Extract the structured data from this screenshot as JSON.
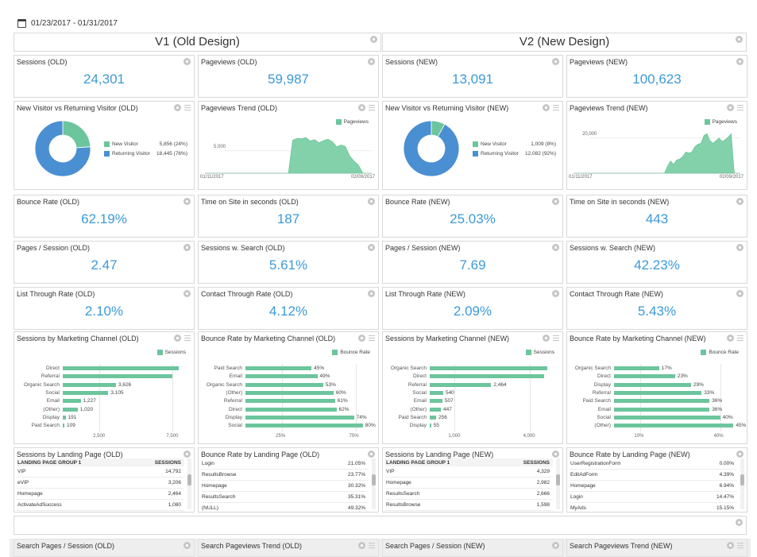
{
  "date_range": "01/23/2017 - 01/31/2017",
  "headers": {
    "left": "V1 (Old Design)",
    "right": "V2 (New Design)"
  },
  "kpis": {
    "sessions_old": {
      "title": "Sessions (OLD)",
      "value": "24,301"
    },
    "pageviews_old": {
      "title": "Pageviews (OLD)",
      "value": "59,987"
    },
    "sessions_new": {
      "title": "Sessions (NEW)",
      "value": "13,091"
    },
    "pageviews_new": {
      "title": "Pageviews (NEW)",
      "value": "100,623"
    },
    "bounce_old": {
      "title": "Bounce Rate (OLD)",
      "value": "62.19%"
    },
    "time_old": {
      "title": "Time on Site in seconds (OLD)",
      "value": "187"
    },
    "bounce_new": {
      "title": "Bounce Rate (NEW)",
      "value": "25.03%"
    },
    "time_new": {
      "title": "Time on Site in seconds (NEW)",
      "value": "443"
    },
    "pps_old": {
      "title": "Pages / Session (OLD)",
      "value": "2.47"
    },
    "search_old": {
      "title": "Sessions w. Search (OLD)",
      "value": "5.61%"
    },
    "pps_new": {
      "title": "Pages / Session (NEW)",
      "value": "7.69"
    },
    "search_new": {
      "title": "Sessions w. Search (NEW)",
      "value": "42.23%"
    },
    "ltr_old": {
      "title": "List Through Rate (OLD)",
      "value": "2.10%"
    },
    "ctr_old": {
      "title": "Contact Through Rate (OLD)",
      "value": "4.12%"
    },
    "ltr_new": {
      "title": "List Through Rate (NEW)",
      "value": "2.09%"
    },
    "ctr_new": {
      "title": "Contact Through Rate (NEW)",
      "value": "5.43%"
    }
  },
  "donut_old": {
    "title": "New Visitor vs Returning Visitor (OLD)",
    "items": [
      {
        "label": "New Visitor",
        "value": "5,856 (24%)",
        "share": 0.24,
        "color": "#6cc59c"
      },
      {
        "label": "Returning Visitor",
        "value": "18,445 (76%)",
        "share": 0.76,
        "color": "#4a8fd1"
      }
    ]
  },
  "donut_new": {
    "title": "New Visitor vs Returning Visitor (NEW)",
    "items": [
      {
        "label": "New Visitor",
        "value": "1,009 (8%)",
        "share": 0.08,
        "color": "#6cc59c"
      },
      {
        "label": "Returning Visitor",
        "value": "12,082 (92%)",
        "share": 0.92,
        "color": "#4a8fd1"
      }
    ]
  },
  "trend_old": {
    "title": "Pageviews Trend (OLD)",
    "legend": "Pageviews",
    "ytick": "5,000",
    "x_start": "01/11/2017",
    "x_end": "02/09/2017"
  },
  "trend_new": {
    "title": "Pageviews Trend (NEW)",
    "legend": "Pageviews",
    "ytick": "20,000",
    "x_start": "01/11/2017",
    "x_end": "02/09/2017"
  },
  "bottom_titles": [
    "Search Pages / Session (OLD)",
    "Search Pageviews Trend (OLD)",
    "Search Pages / Session (NEW)",
    "Search Pageviews Trend (NEW)"
  ],
  "tables": {
    "sess_landing_old": {
      "title": "Sessions by Landing Page (OLD)",
      "header": [
        "LANDING PAGE GROUP 1",
        "SESSIONS"
      ],
      "rows": [
        [
          "VIP",
          "14,792"
        ],
        [
          "eVIP",
          "3,206"
        ],
        [
          "Homepage",
          "2,464"
        ],
        [
          "ActivateAdSuccess",
          "1,080"
        ]
      ]
    },
    "bounce_landing_old": {
      "title": "Bounce Rate by Landing Page (OLD)",
      "header": null,
      "rows": [
        [
          "Login",
          "21.05%"
        ],
        [
          "ResultsBrowse",
          "23.77%"
        ],
        [
          "Homepage",
          "30.32%"
        ],
        [
          "ResultsSearch",
          "35.31%"
        ],
        [
          "(NULL)",
          "49.32%"
        ]
      ]
    },
    "sess_landing_new": {
      "title": "Sessions by Landing Page (NEW)",
      "header": [
        "LANDING PAGE GROUP 1",
        "SESSIONS"
      ],
      "rows": [
        [
          "VIP",
          "4,329"
        ],
        [
          "Homepage",
          "2,982"
        ],
        [
          "ResultsSearch",
          "2,666"
        ],
        [
          "ResultsBrowse",
          "1,598"
        ]
      ]
    },
    "bounce_landing_new": {
      "title": "Bounce Rate by Landing Page (NEW)",
      "header": null,
      "rows": [
        [
          "UserRegistrationForm",
          "0.00%"
        ],
        [
          "EditAdForm",
          "4.39%"
        ],
        [
          "Homepage",
          "6.94%"
        ],
        [
          "Login",
          "14.47%"
        ],
        [
          "MyAds",
          "15.15%"
        ]
      ]
    }
  },
  "chart_data": [
    {
      "type": "area",
      "title": "Pageviews Trend (OLD)",
      "series": [
        {
          "name": "Pageviews",
          "values": [
            0,
            0,
            0,
            0,
            0,
            0,
            0,
            0,
            0,
            0,
            0,
            0,
            0,
            0,
            0,
            0,
            0,
            0,
            0,
            0,
            7400,
            7800,
            7700,
            8000,
            7200,
            7500,
            6800,
            7300,
            7600,
            7100,
            5900,
            6300,
            6000,
            3800,
            2700,
            1800,
            0,
            0,
            0
          ]
        }
      ],
      "x": [
        "01/11/2017",
        "02/09/2017"
      ],
      "ytick_label": "5,000",
      "legend_position": "top-right"
    },
    {
      "type": "area",
      "title": "Pageviews Trend (NEW)",
      "series": [
        {
          "name": "Pageviews",
          "values": [
            0,
            0,
            0,
            0,
            0,
            0,
            0,
            0,
            0,
            0,
            0,
            0,
            0,
            0,
            0,
            0,
            0,
            0,
            0,
            0,
            0,
            0,
            0,
            0,
            0,
            0,
            0,
            0,
            0,
            0,
            0,
            4000,
            7000,
            5000,
            7500,
            8000,
            9500,
            12000,
            11500,
            12000,
            15000,
            16500,
            17000,
            21500,
            22500,
            18500,
            17000,
            18500,
            20000,
            18000,
            19000,
            20500,
            22500,
            0,
            0,
            0
          ]
        }
      ],
      "x": [
        "01/11/2017",
        "02/09/2017"
      ],
      "ytick_label": "20,000",
      "legend_position": "top-right"
    },
    {
      "type": "bar",
      "title": "Sessions by Marketing Channel (OLD)",
      "series": [
        {
          "name": "Sessions"
        }
      ],
      "categories": [
        "Direct",
        "Referral",
        "Organic Search",
        "Social",
        "Email",
        "(Other)",
        "Display",
        "Paid Search"
      ],
      "values": [
        7900,
        7500,
        3626,
        3105,
        1227,
        1020,
        191,
        109
      ],
      "labels": [
        "",
        "",
        "3,626",
        "3,105",
        "1,227",
        "1,020",
        "191",
        "109"
      ],
      "ticks": [
        "2,500",
        "7,500"
      ],
      "xlim": [
        0,
        8400
      ]
    },
    {
      "type": "bar",
      "title": "Bounce Rate by Marketing Channel (OLD)",
      "series": [
        {
          "name": "Bounce Rate"
        }
      ],
      "categories": [
        "Paid Search",
        "Email",
        "Organic Search",
        "(Other)",
        "Referral",
        "Direct",
        "Display",
        "Social"
      ],
      "values": [
        45,
        49,
        53,
        60,
        61,
        62,
        74,
        80
      ],
      "labels": [
        "45%",
        "49%",
        "53%",
        "60%",
        "61%",
        "62%",
        "74%",
        "80%"
      ],
      "ticks": [
        "25%",
        "75%"
      ],
      "xlim": [
        0,
        85
      ]
    },
    {
      "type": "bar",
      "title": "Sessions by Marketing Channel (NEW)",
      "series": [
        {
          "name": "Sessions"
        }
      ],
      "categories": [
        "Organic Search",
        "Direct",
        "Referral",
        "Social",
        "Email",
        "(Other)",
        "Paid Search",
        "Display"
      ],
      "values": [
        4700,
        4600,
        2464,
        540,
        507,
        447,
        256,
        55
      ],
      "labels": [
        "",
        "",
        "2,464",
        "540",
        "507",
        "447",
        "256",
        "55"
      ],
      "ticks": [
        "1,000",
        "4,000"
      ],
      "xlim": [
        0,
        5000
      ]
    },
    {
      "type": "bar",
      "title": "Bounce Rate by Marketing Channel (NEW)",
      "series": [
        {
          "name": "Bounce Rate"
        }
      ],
      "categories": [
        "Organic Search",
        "Direct",
        "Display",
        "Referral",
        "Paid Search",
        "Email",
        "Social",
        "(Other)"
      ],
      "values": [
        17,
        23,
        29,
        33,
        36,
        36,
        40,
        45
      ],
      "labels": [
        "17%",
        "23%",
        "29%",
        "33%",
        "36%",
        "36%",
        "40%",
        "45%"
      ],
      "ticks": [
        "10%",
        "40%"
      ],
      "xlim": [
        0,
        47
      ]
    }
  ]
}
